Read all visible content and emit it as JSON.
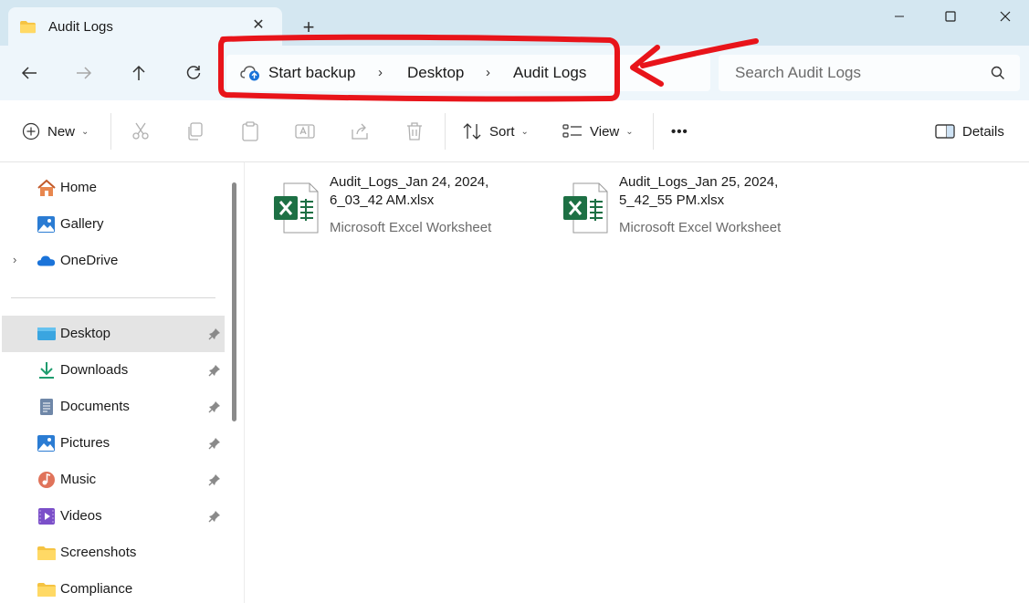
{
  "window": {
    "tab_title": "Audit Logs",
    "new_tab_glyph": "+",
    "close_tab_glyph": "✕"
  },
  "breadcrumb": {
    "items": [
      "Start backup",
      "Desktop",
      "Audit Logs"
    ],
    "separator": "›"
  },
  "search": {
    "placeholder": "Search Audit Logs"
  },
  "commands": {
    "new_label": "New",
    "sort_label": "Sort",
    "view_label": "View",
    "more_label": "•••",
    "details_label": "Details"
  },
  "sidebar": {
    "items": [
      {
        "label": "Home",
        "icon": "home-icon"
      },
      {
        "label": "Gallery",
        "icon": "gallery-icon"
      },
      {
        "label": "OneDrive",
        "icon": "onedrive-icon"
      },
      {
        "label": "Desktop",
        "icon": "desktop-icon",
        "pinned": true,
        "selected": true
      },
      {
        "label": "Downloads",
        "icon": "downloads-icon",
        "pinned": true
      },
      {
        "label": "Documents",
        "icon": "documents-icon",
        "pinned": true
      },
      {
        "label": "Pictures",
        "icon": "pictures-icon",
        "pinned": true
      },
      {
        "label": "Music",
        "icon": "music-icon",
        "pinned": true
      },
      {
        "label": "Videos",
        "icon": "videos-icon",
        "pinned": true
      },
      {
        "label": "Screenshots",
        "icon": "folder-icon"
      },
      {
        "label": "Compliance",
        "icon": "folder-icon"
      }
    ]
  },
  "files": [
    {
      "name": "Audit_Logs_Jan 24, 2024, 6_03_42 AM.xlsx",
      "type": "Microsoft Excel Worksheet",
      "icon": "excel-file-icon"
    },
    {
      "name": "Audit_Logs_Jan 25, 2024, 5_42_55 PM.xlsx",
      "type": "Microsoft Excel Worksheet",
      "icon": "excel-file-icon"
    }
  ],
  "colors": {
    "title_bar": "#d4e7f1",
    "nav_bar": "#eef6fb",
    "annotation": "#e8141a",
    "excel_green": "#1d7044",
    "selected_item": "#e4e4e4"
  }
}
